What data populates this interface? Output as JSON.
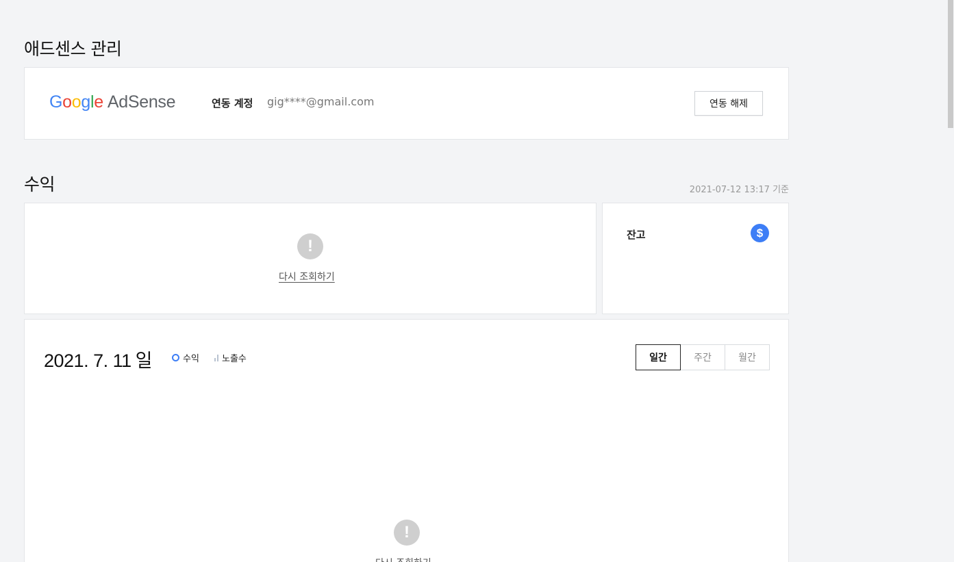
{
  "adsense_section": {
    "title": "애드센스 관리",
    "logo_text": "AdSense",
    "linked_label": "연동 계정",
    "linked_email": "gig****@gmail.com",
    "unlink_button": "연동 해제"
  },
  "revenue_section": {
    "title": "수익",
    "timestamp": "2021-07-12 13:17 기준",
    "retry_label": "다시 조회하기",
    "balance_label": "잔고",
    "alert_glyph": "!",
    "dollar_glyph": "$"
  },
  "chart_panel": {
    "date": "2021. 7. 11",
    "day": "일",
    "legend": {
      "revenue": "수익",
      "impressions": "노출수"
    },
    "tabs": [
      "일간",
      "주간",
      "월간"
    ],
    "active_tab": "일간",
    "retry_label": "다시 조회하기"
  },
  "colors": {
    "accent": "#3d7ef6",
    "background": "#f3f4f6",
    "alert_icon": "#cfcfcf"
  },
  "icons": {
    "alert": "exclamation-circle-icon",
    "balance": "dollar-icon",
    "legend_revenue": "ring-icon",
    "legend_impressions": "bar-icon"
  }
}
